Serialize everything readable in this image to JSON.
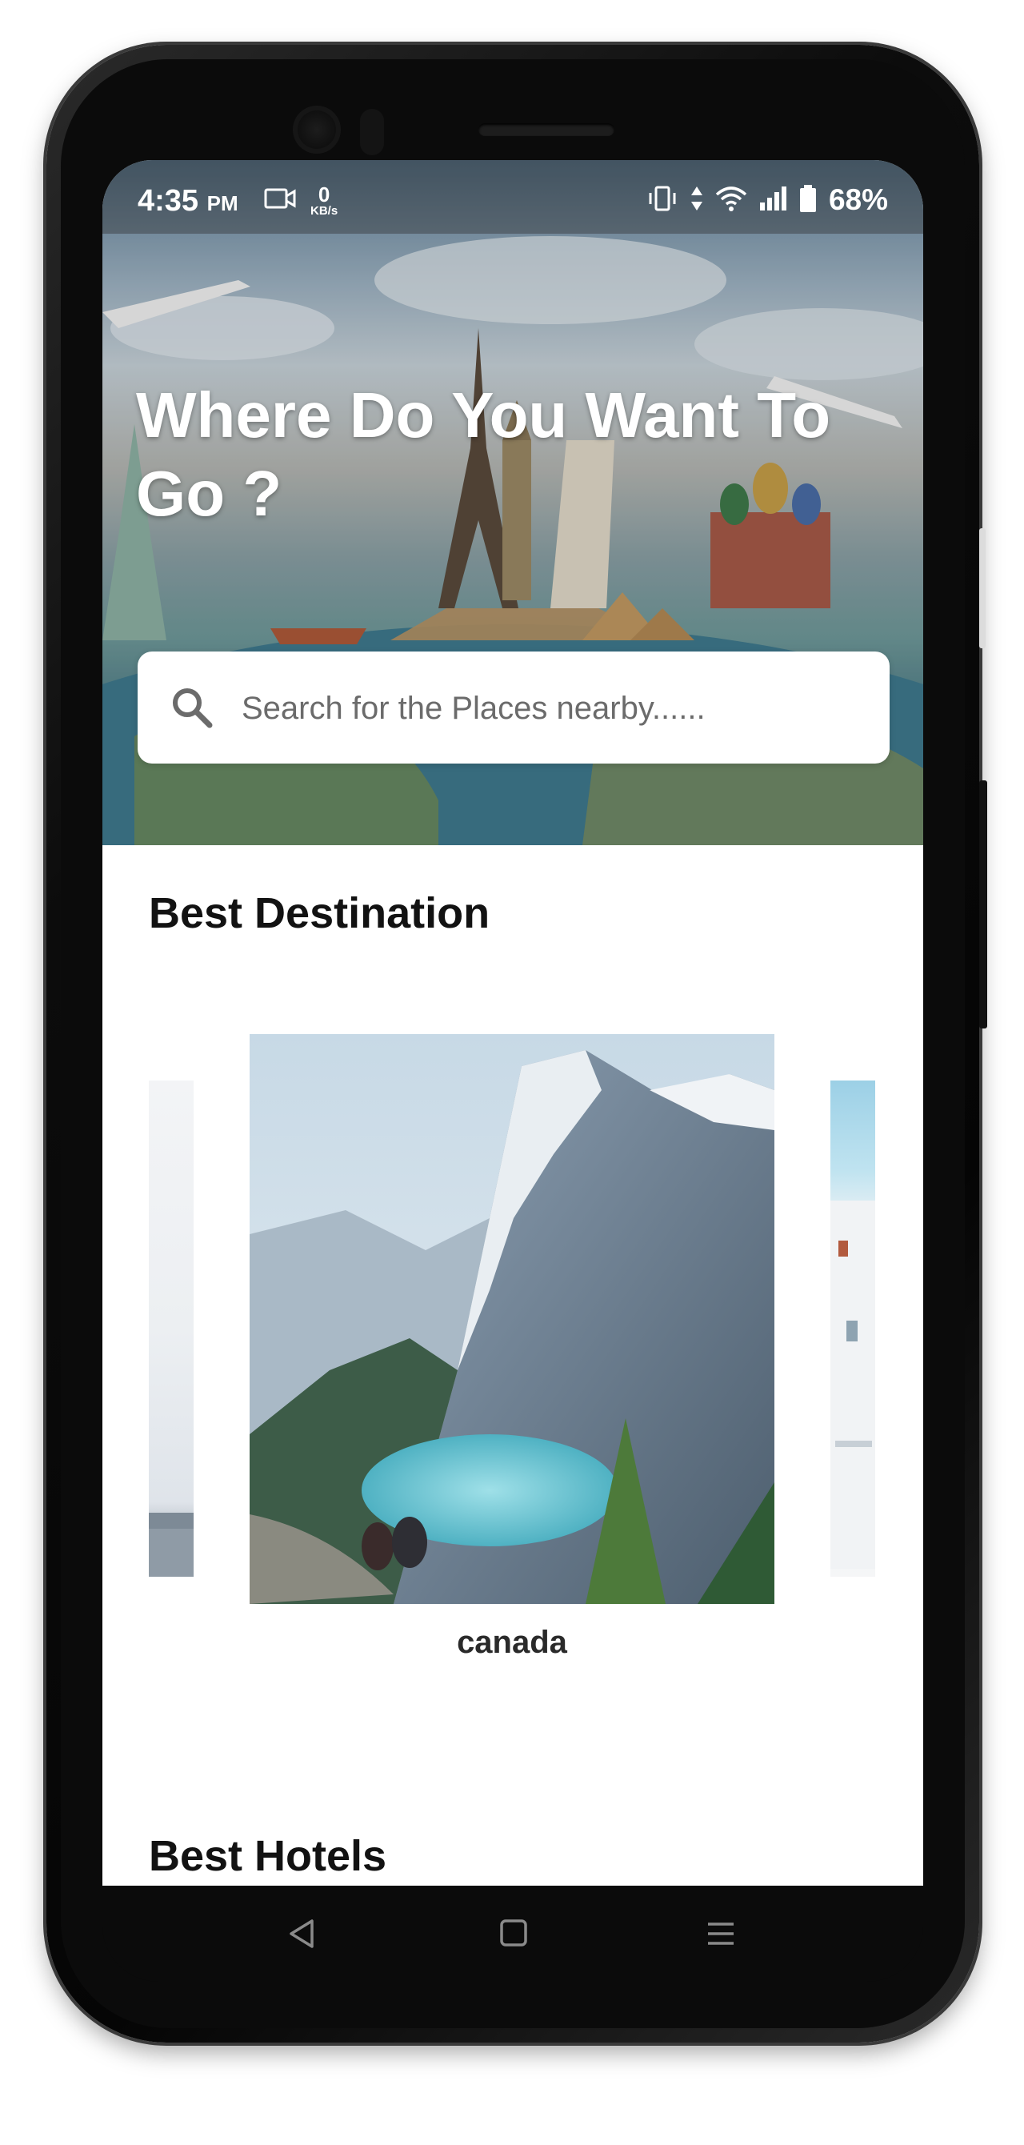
{
  "status_bar": {
    "time": "4:35",
    "time_suffix": "PM",
    "data_speed_value": "0",
    "data_speed_unit": "KB/s",
    "battery": "68%"
  },
  "hero": {
    "headline": "Where Do You Want To Go ?"
  },
  "search": {
    "placeholder": "Search for the Places nearby......"
  },
  "destinations": {
    "title": "Best Destination",
    "featured_caption": "canada"
  },
  "hotels": {
    "title": "Best Hotels"
  },
  "icons": {
    "search": "search-icon",
    "video": "video-call-icon",
    "vibrate": "vibrate-icon",
    "data": "data-arrows-icon",
    "wifi": "wifi-icon",
    "signal": "signal-icon",
    "battery": "battery-icon",
    "nav_back": "back-icon",
    "nav_home": "home-icon",
    "nav_menu": "menu-icon"
  }
}
